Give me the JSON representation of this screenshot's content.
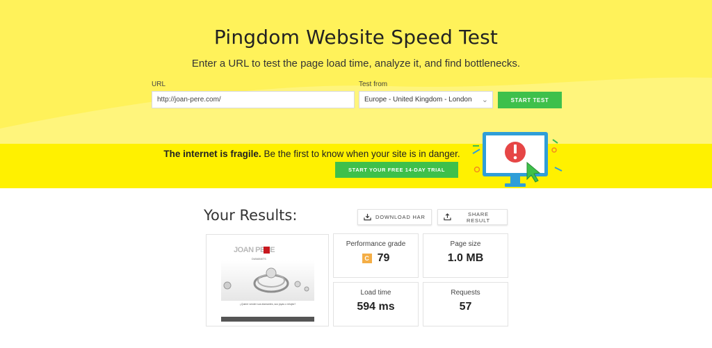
{
  "hero": {
    "title": "Pingdom Website Speed Test",
    "subtitle": "Enter a URL to test the page load time, analyze it, and find bottlenecks.",
    "url_label": "URL",
    "url_value": "http://joan-pere.com/",
    "test_from_label": "Test from",
    "test_from_value": "Europe - United Kingdom - London",
    "start_button": "START TEST"
  },
  "banner": {
    "bold": "The internet is fragile.",
    "text": " Be the first to know when your site is in danger.",
    "cta": "START YOUR FREE 14-DAY TRIAL",
    "illustration_icon": "monitor-alert-icon"
  },
  "results": {
    "title": "Your Results:",
    "download_label": "DOWNLOAD HAR",
    "share_label": "SHARE RESULT",
    "screenshot": {
      "logo": "JOAN PERE",
      "logo_sub": "DIAMANTS",
      "caption": "¿Quiere vender sus diamantes, sus joyas o relojes?"
    },
    "metrics": {
      "performance_label": "Performance grade",
      "performance_grade": "C",
      "performance_value": "79",
      "page_size_label": "Page size",
      "page_size_value": "1.0 MB",
      "load_time_label": "Load time",
      "load_time_value": "594 ms",
      "requests_label": "Requests",
      "requests_value": "57"
    }
  },
  "colors": {
    "hero_bg": "#fff25a",
    "banner_bg": "#fff100",
    "button_green": "#3ec04b",
    "grade_orange": "#f4ae46",
    "alert_red": "#e64646",
    "monitor_blue": "#2f9ed8"
  }
}
